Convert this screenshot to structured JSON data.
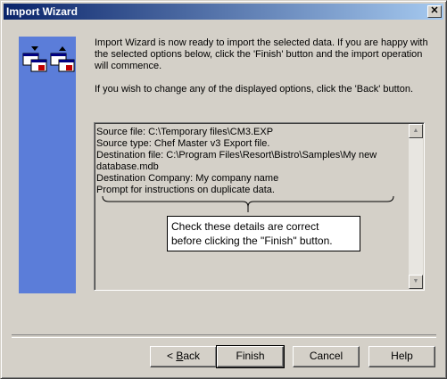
{
  "window": {
    "title": "Import Wizard",
    "close_glyph": "✕"
  },
  "side_panel": {
    "icons": [
      "export-icon",
      "import-icon"
    ],
    "color": "#5b7dd9"
  },
  "intro": {
    "paragraph1": "Import Wizard is now ready to import the selected data.  If you are happy with the selected options below, click the 'Finish' button and the import operation will commence.",
    "paragraph2": "If you wish to change any of the displayed options, click the 'Back' button."
  },
  "details": {
    "lines": [
      "Source file: C:\\Temporary files\\CM3.EXP",
      "Source type: Chef Master v3 Export file.",
      "Destination file: C:\\Program Files\\Resort\\Bistro\\Samples\\My new database.mdb",
      "Destination Company: My company name",
      "Prompt for instructions on duplicate data."
    ]
  },
  "callout": {
    "line1": "Check these details are correct",
    "line2": "before clicking the \"Finish\" button."
  },
  "buttons": {
    "back_prefix": "< ",
    "back_access": "B",
    "back_rest": "ack",
    "finish": "Finish",
    "cancel": "Cancel",
    "help": "Help"
  }
}
